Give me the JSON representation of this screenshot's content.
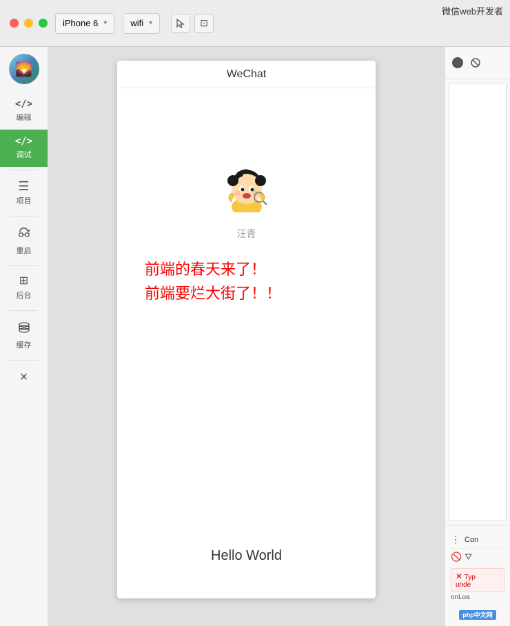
{
  "titlebar": {
    "buttons": {
      "close_label": "close",
      "minimize_label": "minimize",
      "maximize_label": "maximize"
    },
    "device": {
      "name": "iPhone 6",
      "arrow": "▾"
    },
    "network": {
      "name": "wifi",
      "arrow": "▾"
    },
    "app_name": "微信web开发者"
  },
  "sidebar": {
    "avatar_emoji": "🌄",
    "items": [
      {
        "id": "edit",
        "label": "编辑",
        "icon": "</>",
        "active": false
      },
      {
        "id": "debug",
        "label": "调试",
        "icon": "</>",
        "active": true
      },
      {
        "id": "project",
        "label": "项目",
        "icon": "≡",
        "active": false
      },
      {
        "id": "restart",
        "label": "重启",
        "icon": "⟳",
        "active": false
      },
      {
        "id": "backend",
        "label": "后台",
        "icon": "+H",
        "active": false
      },
      {
        "id": "cache",
        "label": "缓存",
        "icon": "⊞",
        "active": false
      },
      {
        "id": "close",
        "label": "×",
        "icon": "×",
        "active": false
      }
    ]
  },
  "phone": {
    "title": "WeChat",
    "username": "汪青",
    "message_line1": "前端的春天来了！",
    "message_line2": "前端要烂大街了！！",
    "footer_text": "Hello World"
  },
  "right_panel": {
    "toolbar_label": "Con",
    "error_type": "Typ",
    "error_detail": "unde",
    "on_load": "onLoa",
    "php_badge": "php中文网"
  }
}
